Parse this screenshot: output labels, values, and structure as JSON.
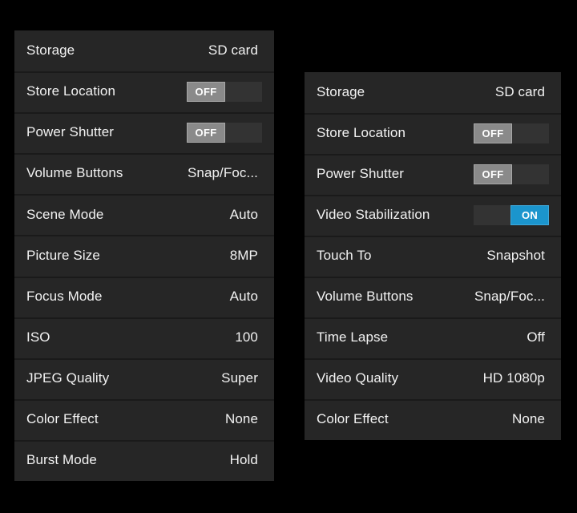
{
  "theme": {
    "page_background": "#000000",
    "panel_background": "#262626",
    "row_divider": "#1a1a1a",
    "text_color": "#f2f2f2",
    "switch_track": "#333333",
    "switch_off_thumb": "#8a8a8a",
    "switch_on_thumb": "#1b95cd"
  },
  "panels": [
    {
      "id": "photo-settings",
      "name": "photo-settings-panel",
      "rows": [
        {
          "label": "Storage",
          "type": "value",
          "value": "SD card"
        },
        {
          "label": "Store Location",
          "type": "toggle",
          "value": "OFF",
          "state": "off"
        },
        {
          "label": "Power Shutter",
          "type": "toggle",
          "value": "OFF",
          "state": "off"
        },
        {
          "label": "Volume Buttons",
          "type": "value",
          "value": "Snap/Foc..."
        },
        {
          "label": "Scene Mode",
          "type": "value",
          "value": "Auto"
        },
        {
          "label": "Picture Size",
          "type": "value",
          "value": "8MP"
        },
        {
          "label": "Focus Mode",
          "type": "value",
          "value": "Auto"
        },
        {
          "label": "ISO",
          "type": "value",
          "value": "100"
        },
        {
          "label": "JPEG Quality",
          "type": "value",
          "value": "Super"
        },
        {
          "label": "Color Effect",
          "type": "value",
          "value": "None"
        },
        {
          "label": "Burst Mode",
          "type": "value",
          "value": "Hold"
        }
      ]
    },
    {
      "id": "video-settings",
      "name": "video-settings-panel",
      "rows": [
        {
          "label": "Storage",
          "type": "value",
          "value": "SD card"
        },
        {
          "label": "Store Location",
          "type": "toggle",
          "value": "OFF",
          "state": "off"
        },
        {
          "label": "Power Shutter",
          "type": "toggle",
          "value": "OFF",
          "state": "off"
        },
        {
          "label": "Video Stabilization",
          "type": "toggle",
          "value": "ON",
          "state": "on"
        },
        {
          "label": "Touch To",
          "type": "value",
          "value": "Snapshot"
        },
        {
          "label": "Volume Buttons",
          "type": "value",
          "value": "Snap/Foc..."
        },
        {
          "label": "Time Lapse",
          "type": "value",
          "value": "Off"
        },
        {
          "label": "Video Quality",
          "type": "value",
          "value": "HD 1080p"
        },
        {
          "label": "Color Effect",
          "type": "value",
          "value": "None"
        }
      ]
    }
  ]
}
